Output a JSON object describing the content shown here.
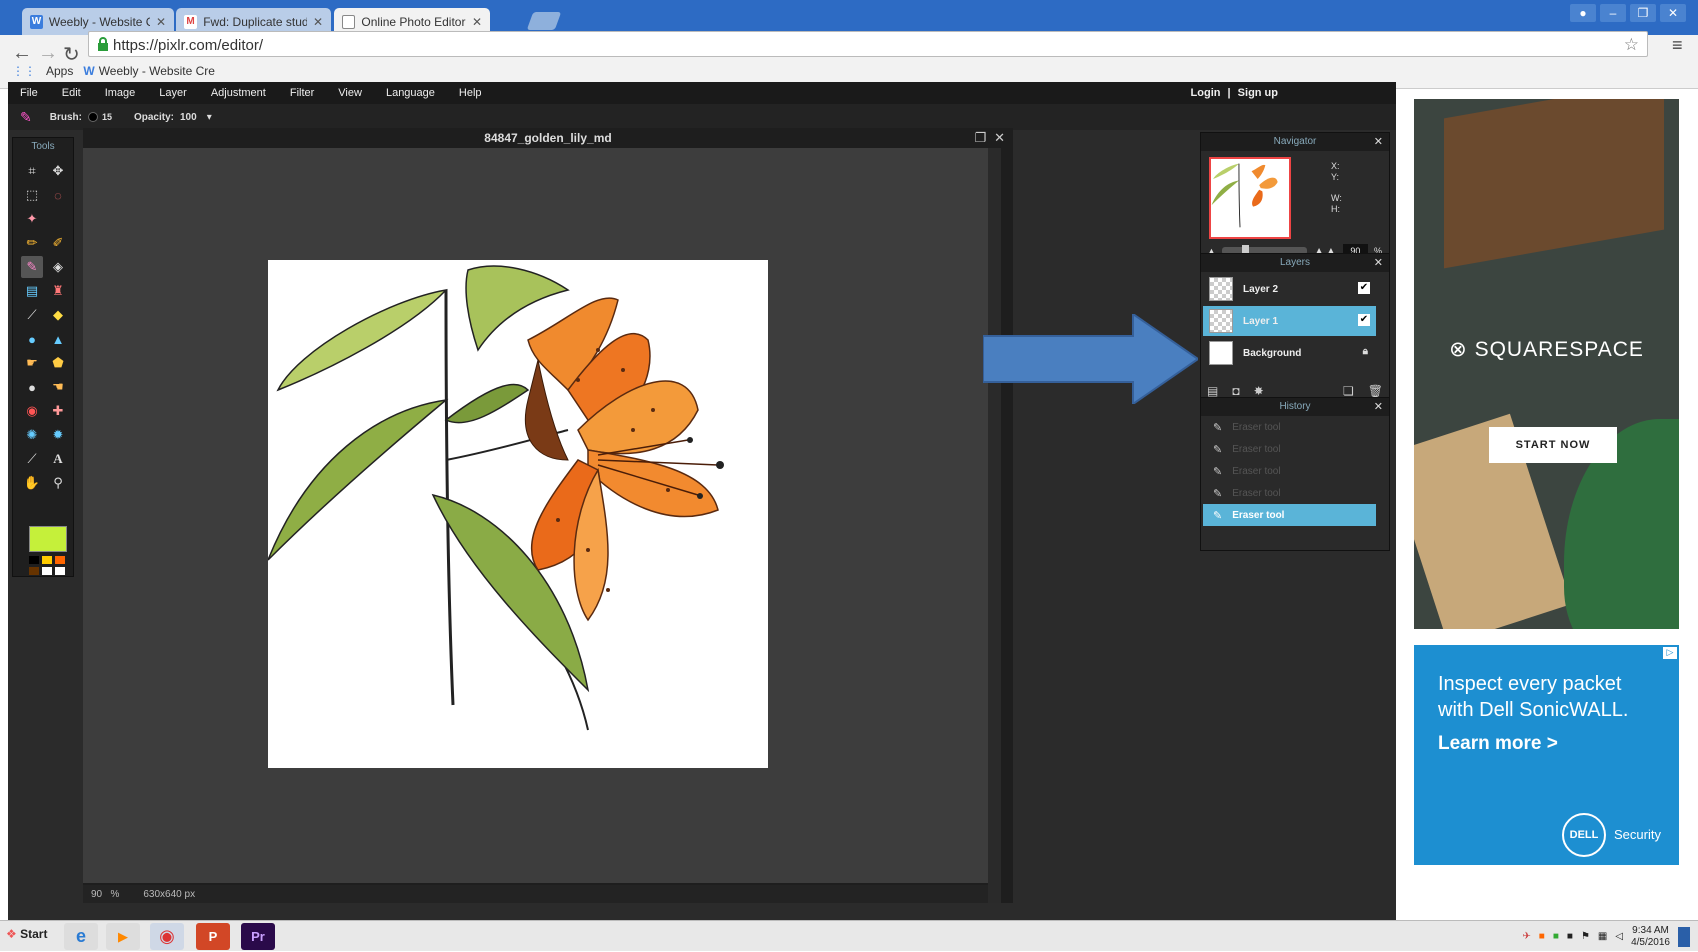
{
  "browser": {
    "tabs": [
      {
        "title": "Weebly - Website Creatio",
        "icon_text": "W",
        "color": "#3b7ddd"
      },
      {
        "title": "Fwd: Duplicate students in",
        "icon_text": "M",
        "color": "#d44"
      },
      {
        "title": "Online Photo Editor | Pixlr",
        "icon_text": "",
        "color": "#888"
      }
    ],
    "url": "https://pixlr.com/editor/",
    "bookmarks": {
      "apps": "Apps",
      "weebly": "Weebly - Website Cre"
    }
  },
  "pixlr": {
    "menu": [
      "File",
      "Edit",
      "Image",
      "Layer",
      "Adjustment",
      "Filter",
      "View",
      "Language",
      "Help"
    ],
    "auth": {
      "login": "Login",
      "separator": "|",
      "signup": "Sign up"
    },
    "options": {
      "brush_label": "Brush:",
      "brush_size": "15",
      "opacity_label": "Opacity:",
      "opacity_value": "100"
    },
    "tools_title": "Tools",
    "foreground_color": "#c5f03a",
    "document": {
      "title": "84847_golden_lily_md",
      "zoom": "90",
      "zoom_unit": "%",
      "size": "630x640 px"
    },
    "navigator": {
      "title": "Navigator",
      "x": "X:",
      "y": "Y:",
      "w": "W:",
      "h": "H:",
      "zoom": "90",
      "zoom_unit": "%"
    },
    "layers": {
      "title": "Layers",
      "items": [
        {
          "name": "Layer 2",
          "visible": true,
          "selected": false
        },
        {
          "name": "Layer 1",
          "visible": true,
          "selected": true
        },
        {
          "name": "Background",
          "locked": true,
          "selected": false
        }
      ]
    },
    "history": {
      "title": "History",
      "items": [
        "Eraser tool",
        "Eraser tool",
        "Eraser tool",
        "Eraser tool",
        "Eraser tool"
      ],
      "selected_index": 4
    }
  },
  "ads": {
    "squarespace": {
      "brand": "SQUARESPACE",
      "cta": "START NOW"
    },
    "dell": {
      "line1": "Inspect every packet with Dell SonicWALL.",
      "line2": "Learn more >",
      "logo": "DELL",
      "tag": "Security"
    }
  },
  "taskbar": {
    "start": "Start",
    "time": "9:34 AM",
    "date": "4/5/2016"
  },
  "icons": [
    "back-icon",
    "forward-icon",
    "reload-icon",
    "lock-icon",
    "star-icon",
    "menu-icon",
    "apps-icon"
  ]
}
